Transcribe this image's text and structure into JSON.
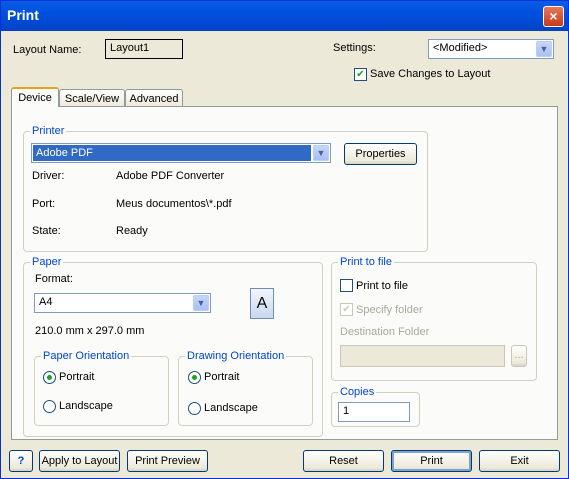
{
  "window": {
    "title": "Print",
    "close_glyph": "×"
  },
  "layout_name": {
    "label": "Layout Name:",
    "value": "Layout1"
  },
  "settings": {
    "label": "Settings:",
    "value": "<Modified>"
  },
  "save_changes": {
    "label": "Save Changes to Layout",
    "checked": true
  },
  "tabs": [
    {
      "label": "Device",
      "active": true
    },
    {
      "label": "Scale/View",
      "active": false
    },
    {
      "label": "Advanced",
      "active": false
    }
  ],
  "printer": {
    "group_label": "Printer",
    "selected": "Adobe PDF",
    "properties_label": "Properties",
    "driver_label": "Driver:",
    "driver_value": "Adobe PDF Converter",
    "port_label": "Port:",
    "port_value": "Meus documentos\\*.pdf",
    "state_label": "State:",
    "state_value": "Ready"
  },
  "paper": {
    "group_label": "Paper",
    "format_label": "Format:",
    "format_value": "A4",
    "size_text": "210.0 mm x 297.0 mm",
    "preview_glyph": "A"
  },
  "paper_orientation": {
    "group_label": "Paper Orientation",
    "portrait": "Portrait",
    "landscape": "Landscape",
    "selected": "portrait"
  },
  "drawing_orientation": {
    "group_label": "Drawing Orientation",
    "portrait": "Portrait",
    "landscape": "Landscape",
    "selected": "portrait"
  },
  "print_to_file": {
    "group_label": "Print to file",
    "print_to_file_label": "Print to file",
    "print_to_file_checked": false,
    "specify_folder_label": "Specify folder",
    "specify_folder_checked": true,
    "destination_label": "Destination Folder",
    "destination_value": "",
    "browse_label": "..."
  },
  "copies": {
    "group_label": "Copies",
    "value": "1"
  },
  "footer": {
    "help_label": "?",
    "apply_label": "Apply to Layout",
    "preview_label": "Print Preview",
    "reset_label": "Reset",
    "print_label": "Print",
    "exit_label": "Exit"
  },
  "colors": {
    "title_bar": "#0054e3",
    "group_label": "#0046d5",
    "selection": "#316ac5",
    "accent_tab": "#e6a21a"
  }
}
